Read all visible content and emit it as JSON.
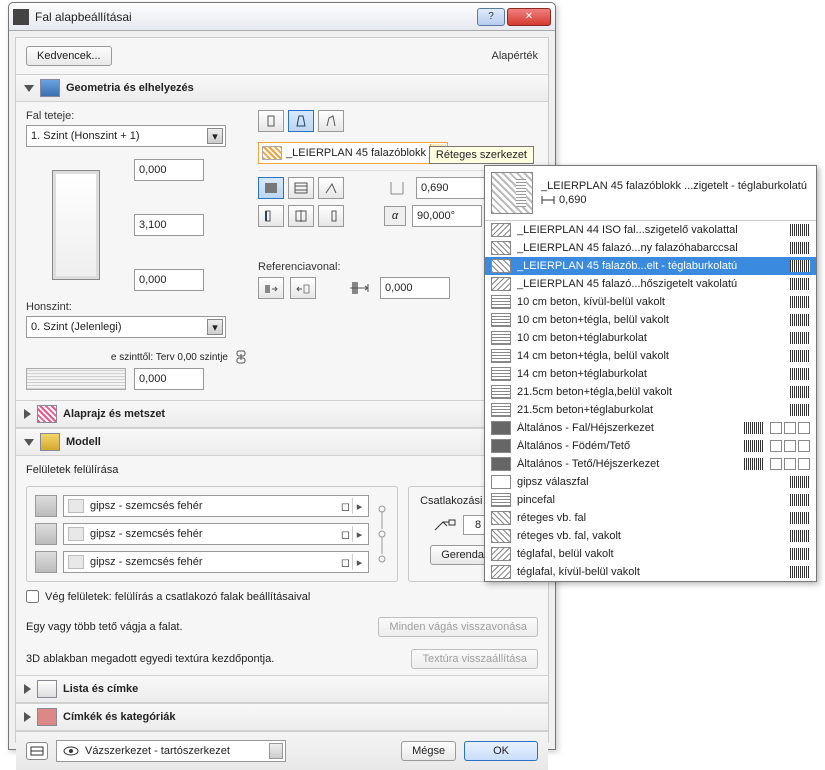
{
  "window": {
    "title": "Fal alapbeállításai"
  },
  "toolbar": {
    "favorites": "Kedvencek...",
    "default": "Alapérték"
  },
  "sections": {
    "geom": "Geometria és elhelyezés",
    "floorplan": "Alaprajz és metszet",
    "model": "Modell",
    "list": "Lista és címke",
    "cat": "Címkék és kategóriák"
  },
  "geom": {
    "topLabel": "Fal teteje:",
    "topStory": "1. Szint (Honszint + 1)",
    "h1": "0,000",
    "h2": "3,100",
    "h3": "0,000",
    "homeLabel": "Honszint:",
    "homeStory": "0. Szint (Jelenlegi)",
    "offsetLabel": "e szinttől: Terv 0,00 szintje",
    "offset": "0,000",
    "composite": "_LEIERPLAN 45 falazóblokk - vékon...",
    "tooltip": "Réteges szerkezet",
    "thickness": "0,690",
    "angle": "90,000°",
    "refLabel": "Referenciavonal:",
    "ref": "0,000",
    "alpha": "α"
  },
  "model": {
    "overrideTitle": "Felületek felülírása",
    "surf": "gipsz - szemcsés fehér",
    "csatTitle": "Csatlakozási sorrend:",
    "csatVal": "8",
    "gerenda": "Gerendafal...",
    "vegCheck": "Vég felületek: felülírás a csatlakozó falak beállításaival"
  },
  "grey": {
    "roof": "Egy vagy több tető vágja a falat.",
    "roofBtn": "Minden vágás visszavonása",
    "tex": "3D ablakban megadott egyedi textúra kezdőpontja.",
    "texBtn": "Textúra visszaállítása"
  },
  "footer": {
    "layer": "Vázszerkezet - tartószerkezet",
    "cancel": "Mégse",
    "ok": "OK"
  },
  "dropdown": {
    "previewName": "_LEIERPLAN 45 falazóblokk ...zigetelt - téglaburkolatú",
    "previewThk": "0,690",
    "items": [
      {
        "t": "_LEIERPLAN 44 ISO fal...szigetelő vakolattal",
        "h": "a",
        "x": 0
      },
      {
        "t": "_LEIERPLAN 45 falazó...ny falazóhabarccsal",
        "h": "b",
        "x": 0
      },
      {
        "t": "_LEIERPLAN 45 falazób...elt - téglaburkolatú",
        "h": "b",
        "x": 0,
        "sel": true
      },
      {
        "t": "_LEIERPLAN 45 falazó...hőszigetelt vakolatú",
        "h": "a",
        "x": 0
      },
      {
        "t": "10 cm beton, kívül-belül vakolt",
        "h": "c",
        "x": 0
      },
      {
        "t": "10 cm beton+tégla, belül vakolt",
        "h": "c",
        "x": 0
      },
      {
        "t": "10 cm beton+téglaburkolat",
        "h": "c",
        "x": 0
      },
      {
        "t": "14 cm beton+tégla, belül vakolt",
        "h": "c",
        "x": 0
      },
      {
        "t": "14 cm beton+téglaburkolat",
        "h": "c",
        "x": 0
      },
      {
        "t": "21.5cm beton+tégla,belül vakolt",
        "h": "c",
        "x": 0
      },
      {
        "t": "21.5cm beton+téglaburkolat",
        "h": "c",
        "x": 0
      },
      {
        "t": "Általános - Fal/Héjszerkezet",
        "h": "d",
        "x": 1
      },
      {
        "t": "Általános - Födém/Tető",
        "h": "d",
        "x": 1
      },
      {
        "t": "Általános - Tető/Héjszerkezet",
        "h": "d",
        "x": 1
      },
      {
        "t": "gipsz válaszfal",
        "h": "e",
        "x": 0
      },
      {
        "t": "pincefal",
        "h": "c",
        "x": 0
      },
      {
        "t": "réteges vb. fal",
        "h": "b",
        "x": 0
      },
      {
        "t": "réteges vb. fal, vakolt",
        "h": "b",
        "x": 0
      },
      {
        "t": "téglafal, belül vakolt",
        "h": "a",
        "x": 0
      },
      {
        "t": "téglafal, kívül-belül vakolt",
        "h": "a",
        "x": 0
      }
    ]
  }
}
